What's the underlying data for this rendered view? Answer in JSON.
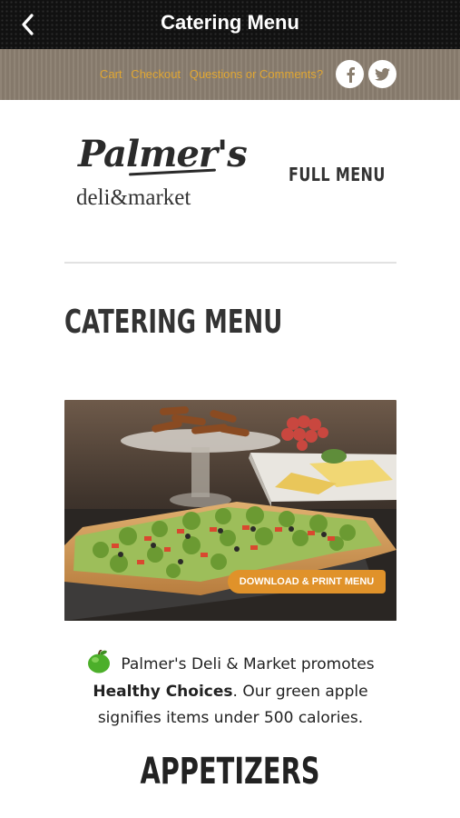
{
  "navbar": {
    "title": "Catering Menu",
    "back_icon": "chevron-left-icon"
  },
  "utility": {
    "links": [
      "Cart",
      "Checkout",
      "Questions or Comments?"
    ],
    "social": [
      "facebook-icon",
      "twitter-icon"
    ],
    "link_color": "#e0a632"
  },
  "logo": {
    "script": "Palmer's",
    "subtitle": "deli&market"
  },
  "nav": {
    "full_menu": "FULL MENU"
  },
  "page": {
    "title": "CATERING MENU"
  },
  "hero": {
    "button": "DOWNLOAD & PRINT MENU",
    "button_color": "#e0922a"
  },
  "healthy": {
    "intro": "Palmer's Deli & Market promotes",
    "bold": "Healthy Choices",
    "rest": ". Our green apple signifies items under 500 calories.",
    "icon": "green-apple-icon"
  },
  "section": {
    "title": "APPETIZERS"
  }
}
